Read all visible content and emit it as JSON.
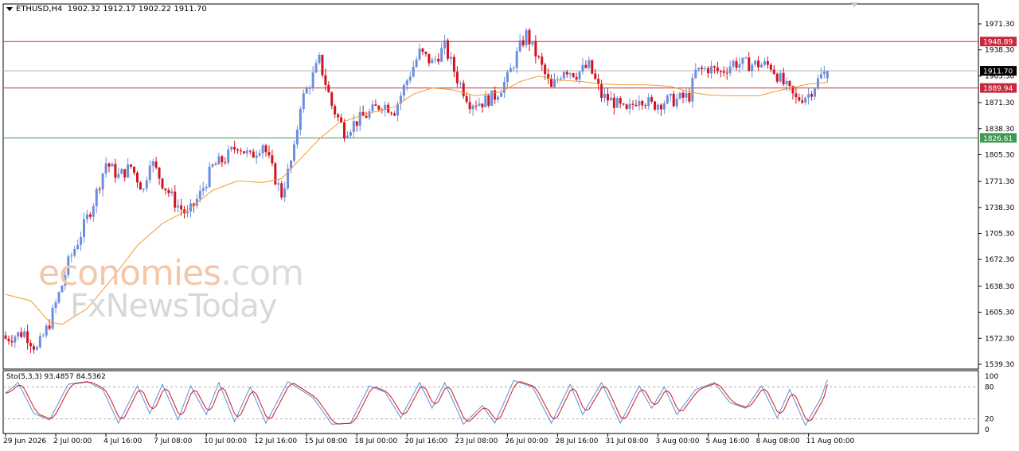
{
  "header": {
    "symbol": "ETHUSD,H4",
    "ohlc": "1902.32 1912.17 1902.22 1911.70"
  },
  "watermark": {
    "line1_part1": "economies",
    "line1_part2": ".com",
    "line2": "FxNewsToday"
  },
  "colors": {
    "bull": "#6c8ee0",
    "bear": "#d2141e",
    "ma": "#f29b30",
    "resistance": "#c8283c",
    "support": "#3c9a50",
    "current": "#000000",
    "stoch_main": "#5b8fd8",
    "stoch_signal": "#d2141e"
  },
  "chart_data": [
    {
      "type": "candlestick",
      "symbol": "ETHUSD",
      "timeframe": "H4",
      "ylim": [
        1539.3,
        1971.3
      ],
      "ytick_labels": [
        "1971.30",
        "1938.30",
        "1905.30",
        "1871.30",
        "1838.30",
        "1805.30",
        "1771.30",
        "1738.30",
        "1705.30",
        "1672.30",
        "1638.30",
        "1605.30",
        "1572.30",
        "1539.30"
      ],
      "ytick_values": [
        1971.3,
        1938.3,
        1905.3,
        1871.3,
        1838.3,
        1805.3,
        1771.3,
        1738.3,
        1705.3,
        1672.3,
        1638.3,
        1605.3,
        1572.3,
        1539.3
      ],
      "xtick_labels": [
        "29 Jun 2026",
        "2 Jul 00:00",
        "4 Jul 16:00",
        "7 Jul 08:00",
        "10 Jul 00:00",
        "12 Jul 16:00",
        "15 Jul 08:00",
        "18 Jul 00:00",
        "20 Jul 16:00",
        "23 Jul 08:00",
        "26 Jul 00:00",
        "28 Jul 16:00",
        "31 Jul 08:00",
        "3 Aug 00:00",
        "5 Aug 16:00",
        "8 Aug 08:00",
        "11 Aug 00:00"
      ],
      "xtick_index": [
        0,
        16,
        32,
        48,
        64,
        80,
        96,
        112,
        128,
        144,
        160,
        176,
        192,
        208,
        224,
        240,
        256
      ],
      "close_path": [
        [
          0,
          1572
        ],
        [
          6,
          1580
        ],
        [
          10,
          1558
        ],
        [
          14,
          1592
        ],
        [
          18,
          1640
        ],
        [
          20,
          1668
        ],
        [
          24,
          1705
        ],
        [
          28,
          1745
        ],
        [
          32,
          1795
        ],
        [
          36,
          1778
        ],
        [
          40,
          1790
        ],
        [
          44,
          1760
        ],
        [
          46,
          1800
        ],
        [
          50,
          1770
        ],
        [
          54,
          1745
        ],
        [
          58,
          1728
        ],
        [
          62,
          1755
        ],
        [
          66,
          1790
        ],
        [
          70,
          1800
        ],
        [
          74,
          1818
        ],
        [
          78,
          1802
        ],
        [
          82,
          1820
        ],
        [
          86,
          1775
        ],
        [
          88,
          1755
        ],
        [
          92,
          1810
        ],
        [
          94,
          1870
        ],
        [
          98,
          1905
        ],
        [
          100,
          1925
        ],
        [
          104,
          1868
        ],
        [
          108,
          1835
        ],
        [
          112,
          1848
        ],
        [
          116,
          1858
        ],
        [
          120,
          1870
        ],
        [
          124,
          1862
        ],
        [
          128,
          1900
        ],
        [
          132,
          1935
        ],
        [
          136,
          1922
        ],
        [
          140,
          1942
        ],
        [
          144,
          1902
        ],
        [
          148,
          1872
        ],
        [
          152,
          1872
        ],
        [
          156,
          1880
        ],
        [
          160,
          1902
        ],
        [
          164,
          1942
        ],
        [
          166,
          1958
        ],
        [
          170,
          1925
        ],
        [
          174,
          1888
        ],
        [
          178,
          1915
        ],
        [
          182,
          1908
        ],
        [
          186,
          1918
        ],
        [
          190,
          1880
        ],
        [
          194,
          1872
        ],
        [
          198,
          1858
        ],
        [
          202,
          1880
        ],
        [
          206,
          1868
        ],
        [
          210,
          1873
        ],
        [
          214,
          1875
        ],
        [
          218,
          1880
        ],
        [
          220,
          1910
        ],
        [
          224,
          1915
        ],
        [
          228,
          1910
        ],
        [
          232,
          1922
        ],
        [
          236,
          1920
        ],
        [
          240,
          1920
        ],
        [
          244,
          1918
        ],
        [
          248,
          1895
        ],
        [
          252,
          1875
        ],
        [
          256,
          1882
        ],
        [
          260,
          1905
        ],
        [
          262,
          1911.7
        ]
      ],
      "last_index": 262,
      "moving_average": [
        [
          0,
          1628
        ],
        [
          8,
          1620
        ],
        [
          14,
          1593
        ],
        [
          18,
          1590
        ],
        [
          26,
          1610
        ],
        [
          34,
          1648
        ],
        [
          42,
          1690
        ],
        [
          50,
          1718
        ],
        [
          58,
          1735
        ],
        [
          66,
          1760
        ],
        [
          74,
          1772
        ],
        [
          82,
          1770
        ],
        [
          88,
          1775
        ],
        [
          94,
          1800
        ],
        [
          100,
          1825
        ],
        [
          106,
          1845
        ],
        [
          112,
          1853
        ],
        [
          118,
          1860
        ],
        [
          124,
          1866
        ],
        [
          130,
          1882
        ],
        [
          136,
          1890
        ],
        [
          142,
          1888
        ],
        [
          150,
          1880
        ],
        [
          158,
          1885
        ],
        [
          164,
          1898
        ],
        [
          170,
          1905
        ],
        [
          176,
          1900
        ],
        [
          184,
          1898
        ],
        [
          190,
          1895
        ],
        [
          196,
          1894
        ],
        [
          204,
          1894
        ],
        [
          212,
          1892
        ],
        [
          218,
          1885
        ],
        [
          224,
          1881
        ],
        [
          232,
          1880
        ],
        [
          240,
          1880
        ],
        [
          248,
          1888
        ],
        [
          256,
          1895
        ],
        [
          262,
          1897
        ]
      ],
      "horizontal_levels": [
        {
          "value": 1948.89,
          "label": "1948.89",
          "kind": "resistance"
        },
        {
          "value": 1889.94,
          "label": "1889.94",
          "kind": "resistance"
        },
        {
          "value": 1826.61,
          "label": "1826.61",
          "kind": "support"
        },
        {
          "value": 1911.7,
          "label": "1911.70",
          "kind": "current"
        }
      ]
    },
    {
      "type": "line",
      "indicator": "Stochastic",
      "label": "Sto(5,3,3) 93.4857 84.5362",
      "main_value": 93.4857,
      "signal_value": 84.5362,
      "ylim": [
        0,
        100
      ],
      "levels": [
        20,
        80
      ],
      "ytick_labels": [
        "100",
        "80",
        "20",
        "0"
      ],
      "ytick_values": [
        100,
        80,
        20,
        0
      ],
      "cycle_peaks": [
        [
          0,
          68
        ],
        [
          4,
          88
        ],
        [
          9,
          30
        ],
        [
          14,
          18
        ],
        [
          20,
          85
        ],
        [
          26,
          90
        ],
        [
          31,
          75
        ],
        [
          36,
          12
        ],
        [
          42,
          82
        ],
        [
          46,
          30
        ],
        [
          50,
          85
        ],
        [
          55,
          18
        ],
        [
          59,
          82
        ],
        [
          64,
          28
        ],
        [
          68,
          88
        ],
        [
          73,
          15
        ],
        [
          78,
          80
        ],
        [
          83,
          12
        ],
        [
          90,
          90
        ],
        [
          98,
          60
        ],
        [
          104,
          10
        ],
        [
          110,
          12
        ],
        [
          116,
          82
        ],
        [
          121,
          70
        ],
        [
          126,
          22
        ],
        [
          132,
          88
        ],
        [
          136,
          40
        ],
        [
          140,
          88
        ],
        [
          146,
          10
        ],
        [
          152,
          45
        ],
        [
          156,
          12
        ],
        [
          162,
          92
        ],
        [
          168,
          80
        ],
        [
          174,
          12
        ],
        [
          180,
          85
        ],
        [
          184,
          28
        ],
        [
          190,
          88
        ],
        [
          196,
          12
        ],
        [
          202,
          82
        ],
        [
          206,
          40
        ],
        [
          210,
          80
        ],
        [
          214,
          28
        ],
        [
          220,
          75
        ],
        [
          226,
          88
        ],
        [
          231,
          50
        ],
        [
          236,
          40
        ],
        [
          241,
          82
        ],
        [
          246,
          22
        ],
        [
          250,
          75
        ],
        [
          255,
          8
        ],
        [
          260,
          60
        ],
        [
          262,
          93.5
        ]
      ]
    }
  ]
}
